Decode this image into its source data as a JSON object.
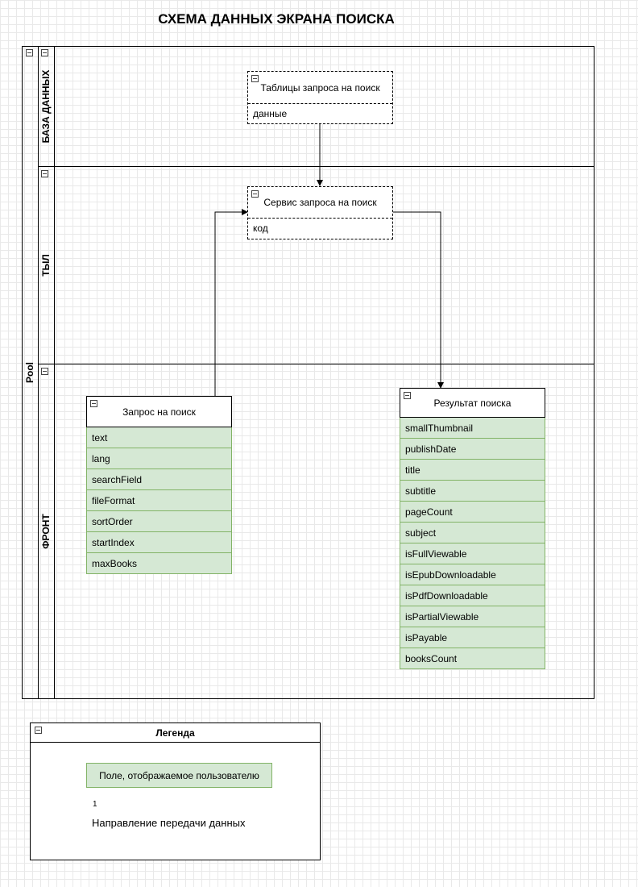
{
  "title": "СХЕМА ДАННЫХ ЭКРАНА ПОИСКА",
  "pool": {
    "label": "Pool"
  },
  "lanes": {
    "db": "БАЗА ДАННЫХ",
    "back": "ТЫЛ",
    "front": "ФРОНТ"
  },
  "entities": {
    "db_tables": {
      "title": "Таблицы запроса на поиск",
      "row": "данные"
    },
    "service": {
      "title": "Сервис запроса на поиск",
      "row": "код"
    },
    "request": {
      "title": "Запрос на поиск",
      "fields": [
        "text",
        "lang",
        "searchField",
        "fileFormat",
        "sortOrder",
        "startIndex",
        "maxBooks"
      ]
    },
    "result": {
      "title": "Результат поиска",
      "fields": [
        "smallThumbnail",
        "publishDate",
        "title",
        "subtitle",
        "pageCount",
        "subject",
        "isFullViewable",
        "isEpubDownloadable",
        "isPdfDownloadable",
        "isPartialViewable",
        "isPayable",
        "booksCount"
      ]
    }
  },
  "legend": {
    "title": "Легенда",
    "sample": "Поле, отображаемое пользователю",
    "arrow_tag": "1",
    "arrow_desc": "Направление передачи данных"
  },
  "colors": {
    "field_fill": "#d5e8d4",
    "field_border": "#82b366",
    "line": "#000000"
  }
}
